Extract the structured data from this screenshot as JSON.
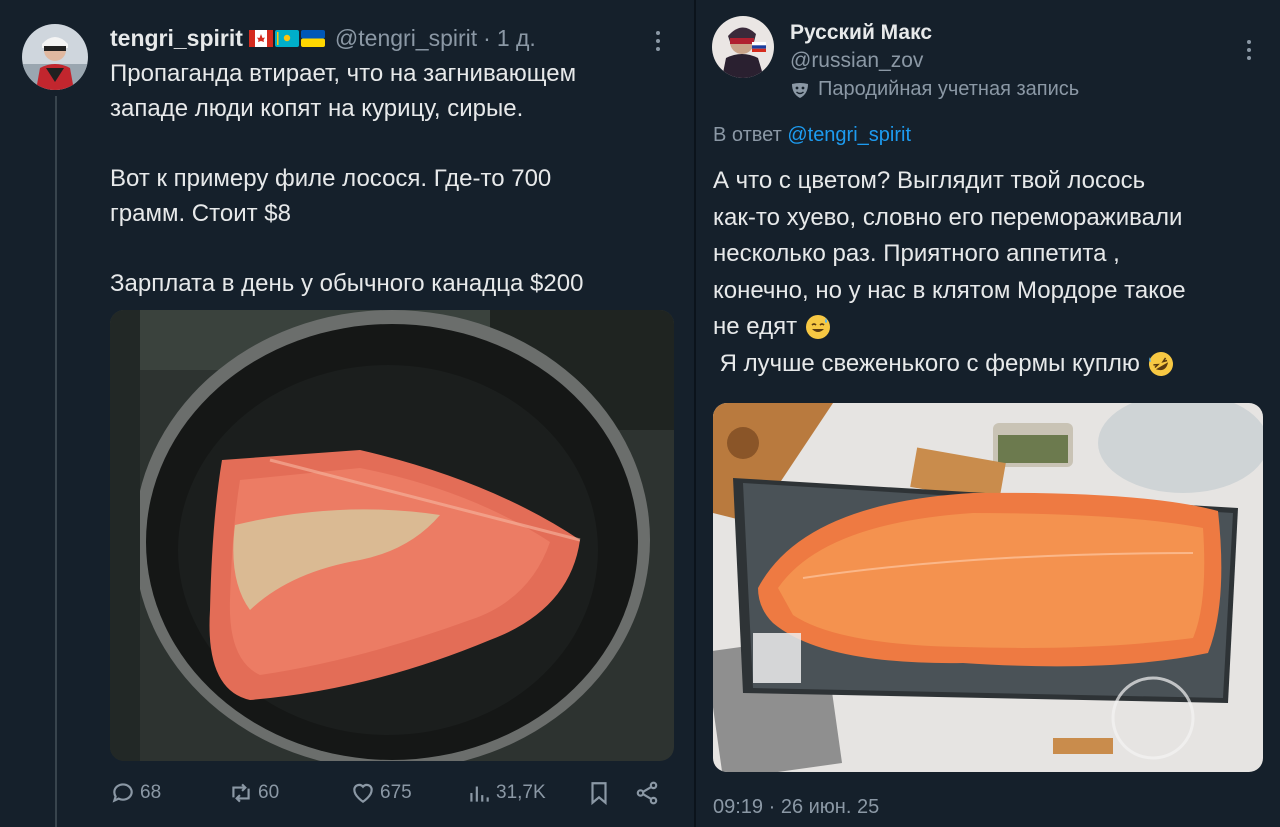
{
  "left_tweet": {
    "display_name": "tengri_spirit",
    "handle": "@tengri_spirit",
    "time_sep": "·",
    "time": "1 д.",
    "text": "Пропаганда втирает, что на загнивающем\nзападе люди копят на курицу, сирые.\n\nВот к примеру филе лосося. Где-то 700\nграмм. Стоит $8\n\nЗарплата в день у обычного канадца $200",
    "actions": {
      "replies": "68",
      "retweets": "60",
      "likes": "675",
      "views": "31,7K"
    },
    "flags": [
      "canada-flag-icon",
      "kazakhstan-flag-icon",
      "ukraine-flag-icon"
    ]
  },
  "right_tweet": {
    "display_name": "Русский Макс",
    "handle": "@russian_zov",
    "parody_label": "Пародийная учетная запись",
    "reply_prefix": "В ответ",
    "reply_to": "@tengri_spirit",
    "text_lines": [
      "А что с цветом? Выглядит твой лосось",
      "как-то хуево, словно его перемораживали",
      "несколько раз.   Приятного аппетита ,",
      "конечно, но у нас в клятом Мордоре такое",
      "не едят"
    ],
    "text_line6": " Я лучше свеженького с фермы куплю",
    "timestamp": "09:19 · 26 июн. 25"
  },
  "colors": {
    "background": "#15202b",
    "text": "#e7e9ea",
    "muted": "#8b98a5",
    "link": "#1d9bf0"
  }
}
